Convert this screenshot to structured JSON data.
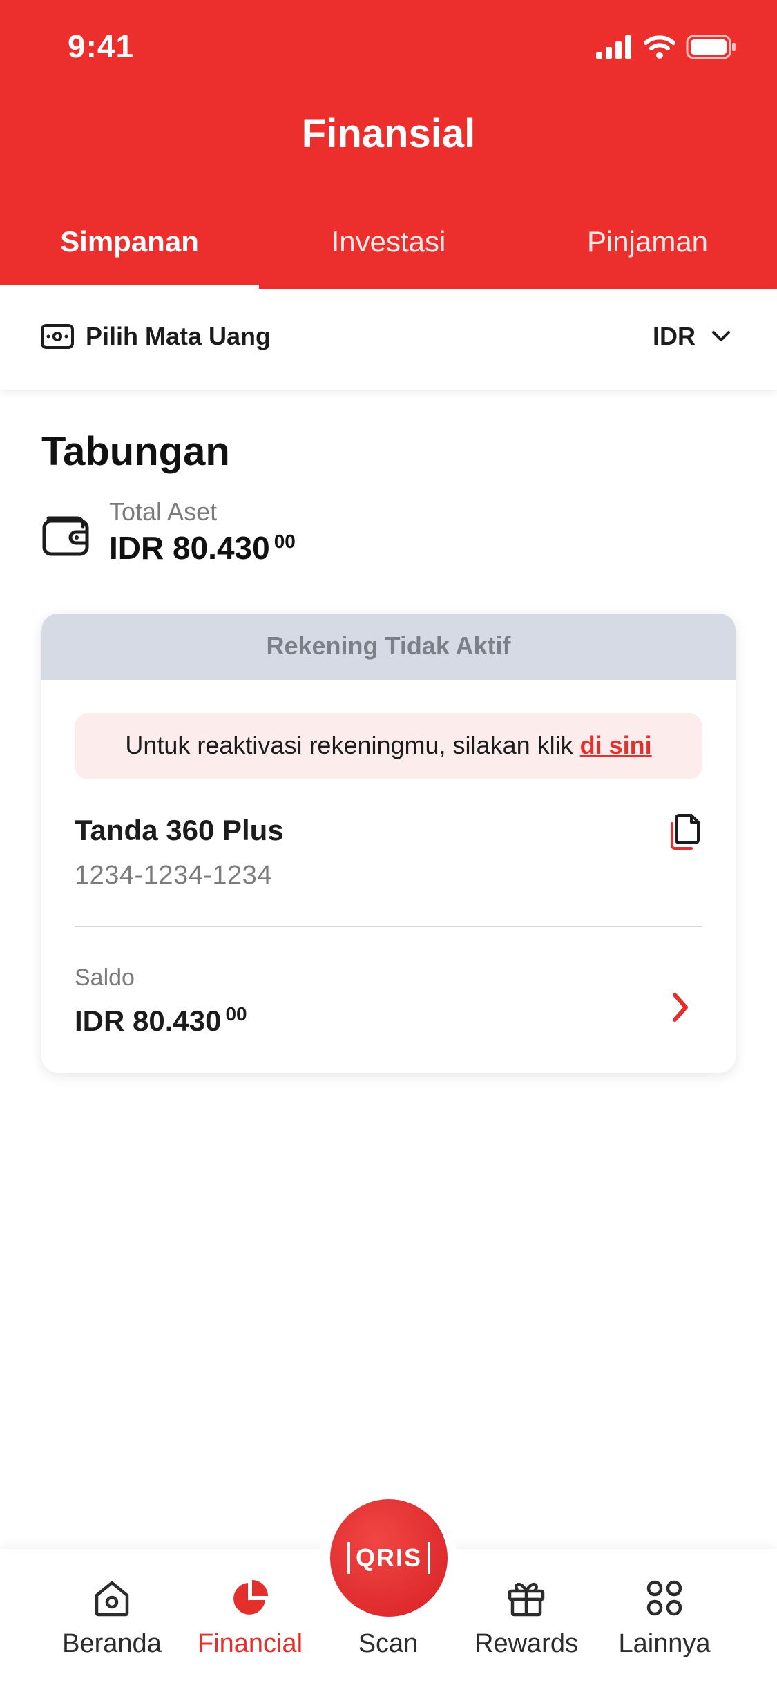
{
  "status_bar": {
    "time": "9:41"
  },
  "header": {
    "title": "Finansial",
    "tabs": [
      {
        "label": "Simpanan",
        "active": true
      },
      {
        "label": "Investasi",
        "active": false
      },
      {
        "label": "Pinjaman",
        "active": false
      }
    ]
  },
  "currency": {
    "label": "Pilih Mata Uang",
    "value": "IDR",
    "icon": "wallet-card-icon"
  },
  "savings": {
    "title": "Tabungan",
    "total_label": "Total Aset",
    "total_amount": "IDR 80.430",
    "total_decimal": "00"
  },
  "account_card": {
    "status": "Rekening Tidak Aktif",
    "notice_text": "Untuk reaktivasi rekeningmu, silakan klik",
    "notice_link": "di sini",
    "product_name": "Tanda 360 Plus",
    "account_number": "1234-1234-1234",
    "balance_label": "Saldo",
    "balance_amount": "IDR 80.430",
    "balance_decimal": "00"
  },
  "bottom_nav": {
    "items": [
      {
        "label": "Beranda",
        "icon": "home-icon",
        "active": false
      },
      {
        "label": "Financial",
        "icon": "pie-chart-icon",
        "active": true
      },
      {
        "label": "Scan",
        "icon": "qris-scan-icon",
        "active": false
      },
      {
        "label": "Rewards",
        "icon": "gift-icon",
        "active": false
      },
      {
        "label": "Lainnya",
        "icon": "grid-icon",
        "active": false
      }
    ],
    "scan_logo_text": "QRIS"
  },
  "colors": {
    "brand_red": "#ec2f2d",
    "inactive_header": "#d6dae4",
    "notice_bg": "#fdecec"
  }
}
